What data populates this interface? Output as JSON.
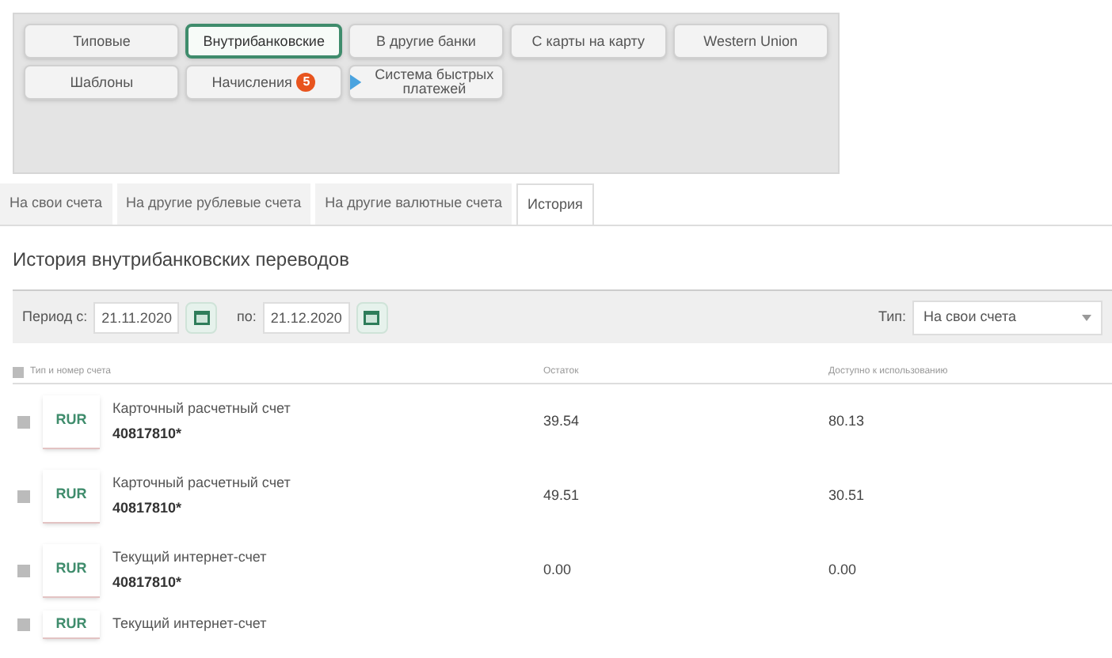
{
  "transfer_buttons": [
    {
      "label": "Типовые",
      "selected": false
    },
    {
      "label": "Внутрибанковские",
      "selected": true
    },
    {
      "label": "В другие банки",
      "selected": false
    },
    {
      "label": "С карты на карту",
      "selected": false
    },
    {
      "label": "Western Union",
      "selected": false
    },
    {
      "label": "Шаблоны",
      "selected": false
    },
    {
      "label": "Начисления",
      "selected": false,
      "badge": "5"
    },
    {
      "label": "Система быстрых платежей",
      "selected": false,
      "kind": "sbp"
    }
  ],
  "tabs": [
    {
      "label": "На свои счета",
      "selected": false
    },
    {
      "label": "На другие рублевые счета",
      "selected": false
    },
    {
      "label": "На другие валютные счета",
      "selected": false
    },
    {
      "label": "История",
      "selected": true
    }
  ],
  "heading": "История внутрибанковских переводов",
  "filter": {
    "from_label": "Период с:",
    "from_value": "21.11.2020",
    "to_label": "по:",
    "to_value": "21.12.2020",
    "type_label": "Тип:",
    "type_value": "На свои счета"
  },
  "table": {
    "select_all_checked": false,
    "columns": [
      "Тип и номер счета",
      "Остаток",
      "Доступно к использованию"
    ],
    "rows": [
      {
        "checked": false,
        "currency": "RUR",
        "name": "Карточный расчетный счет",
        "number": "40817810*",
        "balance": "39.54",
        "available": "80.13"
      },
      {
        "checked": false,
        "currency": "RUR",
        "name": "Карточный расчетный счет",
        "number": "40817810*",
        "balance": "49.51",
        "available": "30.51"
      },
      {
        "checked": false,
        "currency": "RUR",
        "name": "Текущий интернет-счет",
        "number": "40817810*",
        "balance": "0.00",
        "available": "0.00"
      },
      {
        "checked": false,
        "currency": "RUR",
        "name": "Текущий интернет-счет"
      }
    ]
  }
}
